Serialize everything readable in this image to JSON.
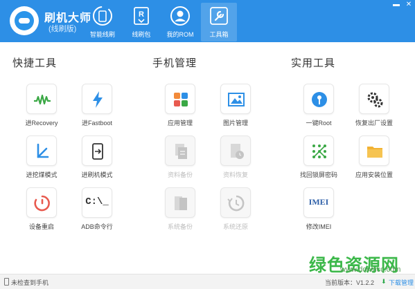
{
  "app": {
    "name": "刷机大师",
    "subtitle": "(线刷版)"
  },
  "nav": [
    {
      "label": "智能线刷",
      "icon": "phone-refresh-icon"
    },
    {
      "label": "线刷包",
      "icon": "rom-package-icon"
    },
    {
      "label": "我的ROM",
      "icon": "user-icon"
    },
    {
      "label": "工具箱",
      "icon": "wrench-icon",
      "active": true
    }
  ],
  "window_controls": {
    "minimize": "▬",
    "close": "✕"
  },
  "sections": {
    "quick": {
      "title": "快捷工具",
      "tools": [
        {
          "label": "进Recovery",
          "icon": "recovery-wave-icon",
          "color": "#3aa845"
        },
        {
          "label": "进Fastboot",
          "icon": "lightning-icon",
          "color": "#2d8fe6"
        },
        {
          "label": "进挖煤模式",
          "icon": "download-mode-icon",
          "color": "#2d8fe6"
        },
        {
          "label": "进刷机模式",
          "icon": "flash-mode-icon",
          "color": "#333333"
        },
        {
          "label": "设备重启",
          "icon": "restart-icon",
          "color": "#e85a4f"
        },
        {
          "label": "ADB命令行",
          "icon": "terminal-icon",
          "glyph": "C:\\_",
          "color": "#333333"
        }
      ]
    },
    "phone": {
      "title": "手机管理",
      "tools": [
        {
          "label": "应用管理",
          "icon": "apps-grid-icon",
          "enabled": true
        },
        {
          "label": "图片管理",
          "icon": "image-icon",
          "enabled": true
        },
        {
          "label": "资料备份",
          "icon": "backup-doc-icon",
          "enabled": false
        },
        {
          "label": "资料恢复",
          "icon": "restore-doc-icon",
          "enabled": false
        },
        {
          "label": "系统备份",
          "icon": "system-backup-icon",
          "enabled": false
        },
        {
          "label": "系统还原",
          "icon": "system-restore-icon",
          "enabled": false
        }
      ]
    },
    "utility": {
      "title": "实用工具",
      "tools": [
        {
          "label": "一键Root",
          "icon": "root-key-icon",
          "color": "#2d8fe6"
        },
        {
          "label": "恢复出厂设置",
          "icon": "gears-icon",
          "color": "#333333"
        },
        {
          "label": "找回锁屏密码",
          "icon": "pattern-lock-icon",
          "color": "#3aa845"
        },
        {
          "label": "应用安装位置",
          "icon": "folder-icon",
          "color": "#f2b233"
        },
        {
          "label": "修改IMEI",
          "icon": "imei-icon",
          "glyph": "IMEI",
          "color": "#2d5fa8"
        }
      ]
    }
  },
  "status": {
    "phone_status": "未检查到手机",
    "version": "当前版本：V1.2.2",
    "download": "下载管理"
  },
  "watermark": {
    "text": "绿色资源网",
    "url": "www.downcc.com"
  }
}
